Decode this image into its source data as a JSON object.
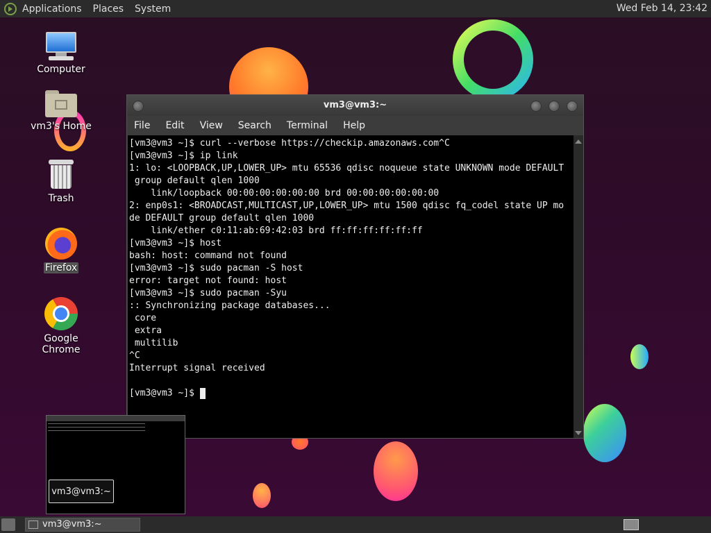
{
  "top_panel": {
    "menus": [
      "Applications",
      "Places",
      "System"
    ],
    "clock": "Wed Feb 14, 23:42"
  },
  "desktop": {
    "icons": [
      {
        "label": "Computer",
        "icon": "computer-icon"
      },
      {
        "label": "vm3's Home",
        "icon": "folder-home-icon"
      },
      {
        "label": "Trash",
        "icon": "trash-icon"
      },
      {
        "label": "Firefox",
        "icon": "firefox-icon"
      },
      {
        "label": "Google Chrome",
        "icon": "chrome-icon"
      }
    ]
  },
  "terminal": {
    "title": "vm3@vm3:~",
    "menu": [
      "File",
      "Edit",
      "View",
      "Search",
      "Terminal",
      "Help"
    ],
    "lines": [
      "[vm3@vm3 ~]$ curl --verbose https://checkip.amazonaws.com^C",
      "[vm3@vm3 ~]$ ip link",
      "1: lo: <LOOPBACK,UP,LOWER_UP> mtu 65536 qdisc noqueue state UNKNOWN mode DEFAULT",
      " group default qlen 1000",
      "    link/loopback 00:00:00:00:00:00 brd 00:00:00:00:00:00",
      "2: enp0s1: <BROADCAST,MULTICAST,UP,LOWER_UP> mtu 1500 qdisc fq_codel state UP mo",
      "de DEFAULT group default qlen 1000",
      "    link/ether c0:11:ab:69:42:03 brd ff:ff:ff:ff:ff:ff",
      "[vm3@vm3 ~]$ host",
      "bash: host: command not found",
      "[vm3@vm3 ~]$ sudo pacman -S host",
      "error: target not found: host",
      "[vm3@vm3 ~]$ sudo pacman -Syu",
      ":: Synchronizing package databases...",
      " core",
      " extra",
      " multilib",
      "^C",
      "Interrupt signal received",
      ""
    ],
    "prompt": "[vm3@vm3 ~]$ "
  },
  "taskbar": {
    "task_label": "vm3@vm3:~",
    "tooltip": "vm3@vm3:~"
  }
}
